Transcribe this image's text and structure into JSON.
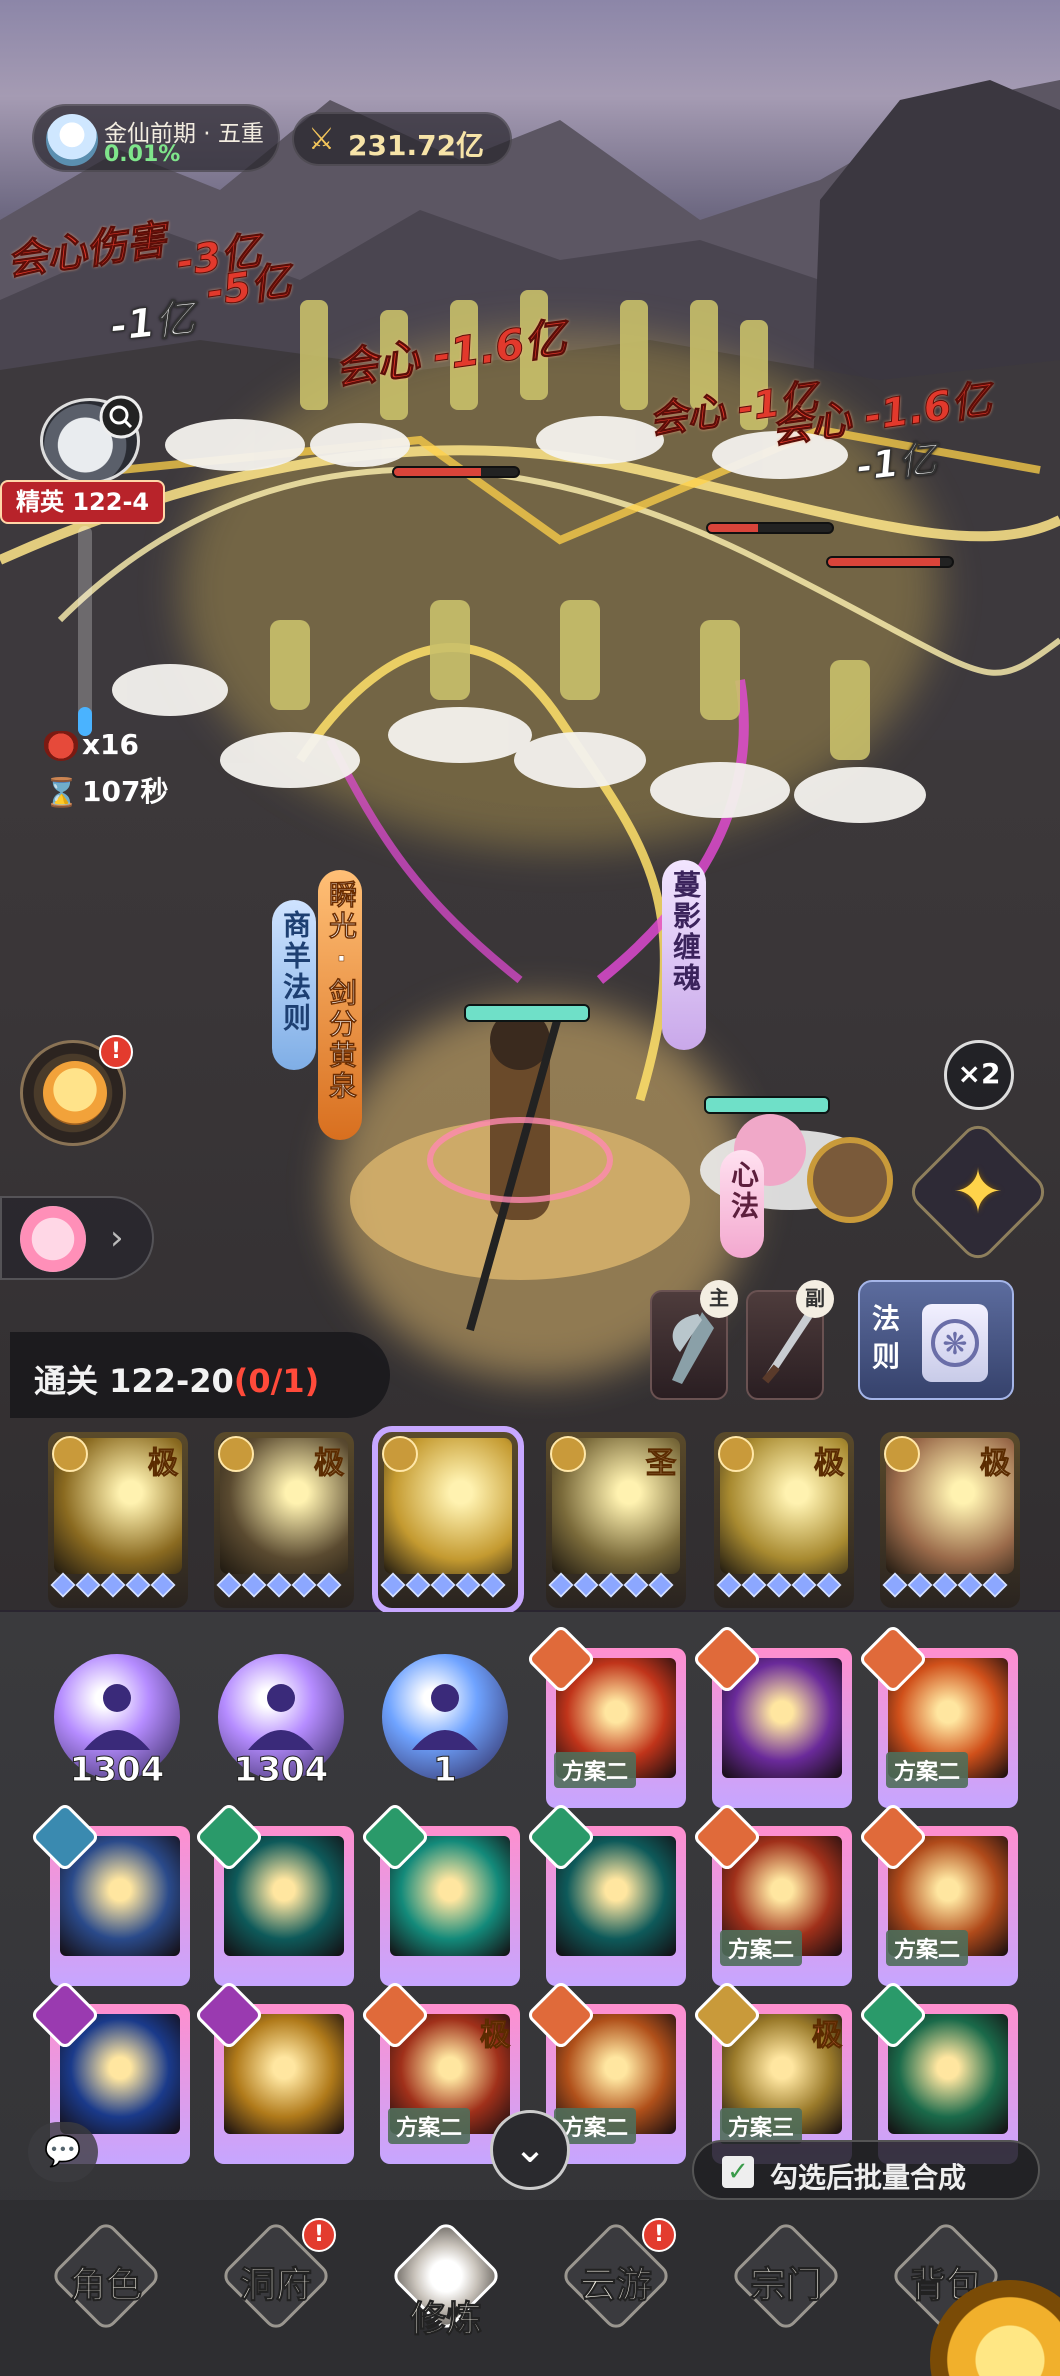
{
  "realm": {
    "title": "金仙前期 · 五重",
    "progress": "0.01%"
  },
  "power": {
    "icon": "crossed-swords-icon",
    "value": "231.72亿"
  },
  "damage_numbers": [
    {
      "text": "会心伤害",
      "color": "red"
    },
    {
      "text": "-3亿",
      "color": "red"
    },
    {
      "text": "-5亿",
      "color": "red"
    },
    {
      "text": "-1亿",
      "color": "white"
    },
    {
      "text": "会心 -1.6亿",
      "color": "red"
    },
    {
      "text": "会心 -1亿",
      "color": "red"
    },
    {
      "text": "会心 -1.6亿",
      "color": "red"
    },
    {
      "text": "-1亿",
      "color": "white"
    }
  ],
  "stage": {
    "badge": "精英 122-4",
    "multiplier": "x16",
    "timer": "107秒",
    "progress_fraction": 0.14
  },
  "skill_banners": [
    {
      "text": "商羊法则",
      "style": "blue"
    },
    {
      "text": "瞬光·剑分黄泉",
      "style": "orange"
    },
    {
      "text": "蔓影缠魂",
      "style": "purple"
    },
    {
      "text": "心法",
      "style": "pink"
    }
  ],
  "speed": "×2",
  "notification_mark": "!",
  "weapons": {
    "main_tag": "主",
    "sub_tag": "副"
  },
  "law_card": {
    "label": "法则"
  },
  "clear": {
    "prefix": "通关 122-20",
    "count": "(0/1)"
  },
  "skill_row": [
    {
      "grade": "极",
      "selected": false
    },
    {
      "grade": "极",
      "selected": false
    },
    {
      "grade": "",
      "selected": true
    },
    {
      "grade": "圣",
      "selected": false
    },
    {
      "grade": "极",
      "selected": false
    },
    {
      "grade": "极",
      "selected": false
    }
  ],
  "orbs": [
    {
      "count": "1304",
      "color": "#b58cff"
    },
    {
      "count": "1304",
      "color": "#b58cff"
    },
    {
      "count": "1",
      "color": "#6fa3ff"
    }
  ],
  "cards_row1": [
    {
      "plan": "方案二",
      "grade": ""
    },
    {
      "plan": "",
      "grade": ""
    },
    {
      "plan": "方案二",
      "grade": ""
    }
  ],
  "cards_row2": [
    {
      "plan": "",
      "grade": ""
    },
    {
      "plan": "",
      "grade": ""
    },
    {
      "plan": "",
      "grade": ""
    },
    {
      "plan": "",
      "grade": ""
    },
    {
      "plan": "方案二",
      "grade": ""
    },
    {
      "plan": "方案二",
      "grade": ""
    }
  ],
  "cards_row3": [
    {
      "plan": "",
      "grade": ""
    },
    {
      "plan": "",
      "grade": ""
    },
    {
      "plan": "方案二",
      "grade": "极"
    },
    {
      "plan": "方案二",
      "grade": ""
    },
    {
      "plan": "方案三",
      "grade": "极"
    },
    {
      "plan": "",
      "grade": ""
    }
  ],
  "batch": {
    "label": "勾选后批量合成",
    "checked": true,
    "check_mark": "✓"
  },
  "nav": [
    {
      "label": "角色",
      "badge": false,
      "active": false
    },
    {
      "label": "洞府",
      "badge": true,
      "active": false
    },
    {
      "label": "修炼",
      "badge": false,
      "active": true
    },
    {
      "label": "云游",
      "badge": true,
      "active": false
    },
    {
      "label": "宗门",
      "badge": false,
      "active": false
    },
    {
      "label": "背包",
      "badge": false,
      "active": false
    }
  ],
  "colors": {
    "accent_gold": "#f3c55a",
    "danger_red": "#e33b2e",
    "hp_green": "#6fe0c8"
  }
}
